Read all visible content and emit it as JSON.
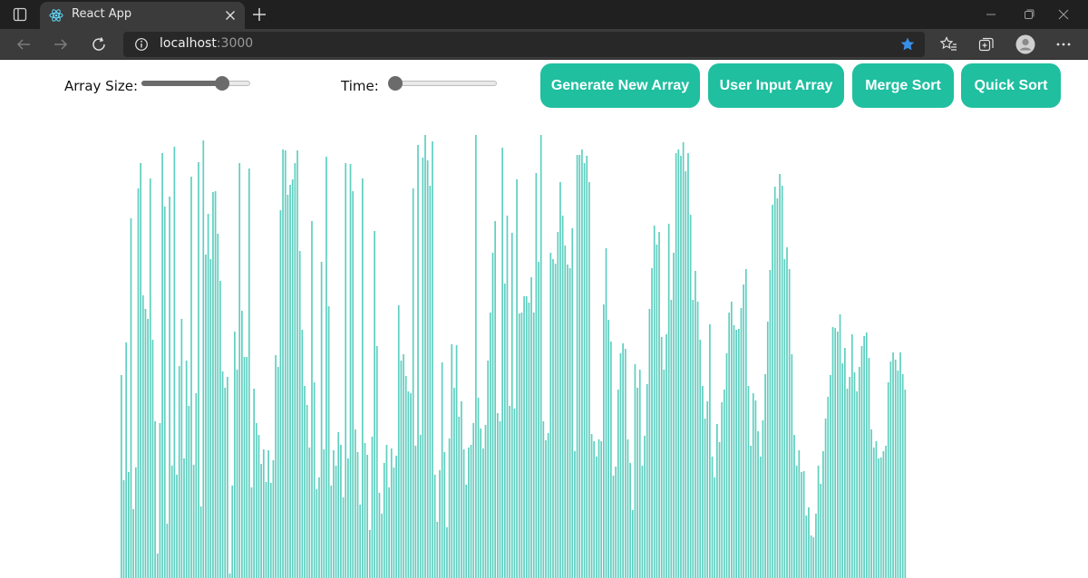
{
  "browser": {
    "tab_title": "React App",
    "url_host": "localhost",
    "url_port": ":3000",
    "icons": [
      "tab-actions-icon",
      "react-icon",
      "close-icon",
      "plus-icon",
      "minimize-icon",
      "maximize-icon",
      "window-close-icon",
      "back-icon",
      "forward-icon",
      "reload-icon",
      "info-icon",
      "star-icon",
      "favorites-icon",
      "collections-icon",
      "profile-icon",
      "more-icon"
    ],
    "accent_star": "#3a8ee6"
  },
  "controls": {
    "size_label": "Array Size:",
    "size_value": 0.78,
    "time_label": "Time:",
    "time_value": 0.0
  },
  "buttons": {
    "generate": "Generate New Array",
    "user_input": "User Input Array",
    "merge_sort": "Merge Sort",
    "quick_sort": "Quick Sort",
    "color": "#1fbfa0"
  },
  "bars": {
    "color": "#5fcfc0",
    "values": [
      224,
      108,
      260,
      117,
      397,
      76,
      122,
      430,
      458,
      312,
      297,
      286,
      441,
      263,
      173,
      27,
      171,
      469,
      410,
      60,
      421,
      124,
      476,
      114,
      234,
      286,
      132,
      240,
      190,
      443,
      125,
      204,
      459,
      79,
      483,
      357,
      402,
      352,
      426,
      427,
      380,
      328,
      228,
      210,
      222,
      5,
      102,
      272,
      230,
      458,
      295,
      244,
      244,
      452,
      100,
      209,
      171,
      158,
      126,
      142,
      106,
      141,
      105,
      130,
      246,
      233,
      406,
      473,
      472,
      423,
      434,
      440,
      458,
      472,
      361,
      274,
      212,
      191,
      144,
      394,
      216,
      98,
      111,
      349,
      142,
      465,
      300,
      102,
      141,
      124,
      161,
      147,
      89,
      458,
      132,
      457,
      427,
      164,
      139,
      81,
      441,
      149,
      136,
      53,
      156,
      383,
      256,
      94,
      71,
      127,
      147,
      100,
      143,
      122,
      135,
      301,
      240,
      247,
      223,
      206,
      204,
      430,
      146,
      478,
      158,
      464,
      489,
      461,
      433,
      482,
      114,
      62,
      119,
      238,
      139,
      56,
      154,
      258,
      210,
      257,
      178,
      195,
      142,
      103,
      144,
      147,
      171,
      489,
      199,
      165,
      143,
      169,
      240,
      293,
      359,
      394,
      182,
      173,
      475,
      325,
      400,
      190,
      381,
      187,
      440,
      292,
      293,
      311,
      311,
      304,
      332,
      293,
      447,
      349,
      489,
      173,
      152,
      160,
      359,
      352,
      347,
      382,
      437,
      400,
      367,
      346,
      342,
      386,
      140,
      467,
      467,
      473,
      458,
      466,
      437,
      159,
      151,
      134,
      153,
      151,
      302,
      364,
      285,
      261,
      113,
      123,
      208,
      248,
      259,
      253,
      153,
      127,
      75,
      236,
      210,
      230,
      124,
      157,
      214,
      297,
      342,
      389,
      368,
      382,
      266,
      230,
      269,
      391,
      307,
      359,
      469,
      473,
      466,
      481,
      449,
      469,
      401,
      307,
      339,
      305,
      263,
      212,
      176,
      195,
      280,
      134,
      111,
      170,
      150,
      194,
      208,
      248,
      293,
      305,
      279,
      274,
      275,
      298,
      324,
      341,
      212,
      146,
      204,
      196,
      162,
      134,
      174,
      225,
      283,
      340,
      412,
      432,
      419,
      446,
      433,
      352,
      365,
      341,
      247,
      158,
      124,
      141,
      117,
      118,
      69,
      78,
      47,
      45,
      71,
      124,
      104,
      140,
      176,
      200,
      224,
      277,
      276,
      272,
      291,
      237,
      254,
      209,
      222,
      269,
      227,
      206,
      233,
      256,
      267,
      271,
      243,
      164,
      144,
      151,
      132,
      133,
      140,
      146,
      216,
      239,
      249,
      241,
      229,
      249,
      225,
      208
    ]
  }
}
